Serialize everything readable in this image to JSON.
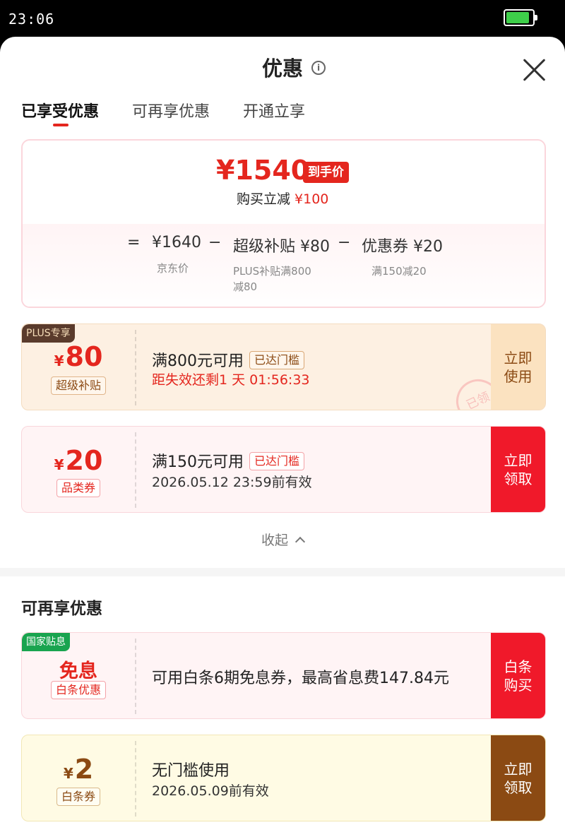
{
  "status_bar": {
    "time": "23:06"
  },
  "header": {
    "title": "优惠",
    "info_icon": "i"
  },
  "tabs": [
    {
      "label": "已享受优惠",
      "active": true
    },
    {
      "label": "可再享优惠",
      "active": false
    },
    {
      "label": "开通立享",
      "active": false
    }
  ],
  "summary": {
    "final_price": "¥1540",
    "final_price_tag": "到手价",
    "reduce_label": "购买立减",
    "reduce_amount": "¥100",
    "equals": "=",
    "minus": "−",
    "base_price": "¥1640",
    "base_label": "京东价",
    "subsidy_label": "超级补贴 ¥80",
    "subsidy_sub_line1": "PLUS补贴满800",
    "subsidy_sub_line2": "减80",
    "coupon_label": "优惠券 ¥20",
    "coupon_sub": "满150减20"
  },
  "coupons": [
    {
      "tag": "PLUS专享",
      "yen": "¥",
      "amount": "80",
      "kind": "超级补贴",
      "title": "满800元可用",
      "reached": "已达门槛",
      "sub": "距失效还剩1 天 01:56:33",
      "stamp": "已领",
      "action": "立即使用"
    },
    {
      "yen": "¥",
      "amount": "20",
      "kind": "品类券",
      "title": "满150元可用",
      "reached": "已达门槛",
      "sub": "2026.05.12 23:59前有效",
      "action": "立即领取"
    }
  ],
  "collapse": {
    "label": "收起",
    "icon": "chevron-up-icon"
  },
  "more_section": {
    "title": "可再享优惠",
    "offers": [
      {
        "tag": "国家贴息",
        "headline": "免息",
        "kind": "白条优惠",
        "title": "可用白条6期免息券，最高省息费147.84元",
        "action": "白条购买"
      },
      {
        "yen": "¥",
        "amount": "2",
        "kind": "白条券",
        "title": "无门槛使用",
        "sub": "2026.05.09前有效",
        "action": "立即领取"
      }
    ]
  },
  "colors": {
    "accent": "#e4261e",
    "brown": "#8b4a13",
    "plus_bg": "#fdf0e2",
    "red_bg": "#fff4f5",
    "yellow_bg": "#fffbe4"
  }
}
